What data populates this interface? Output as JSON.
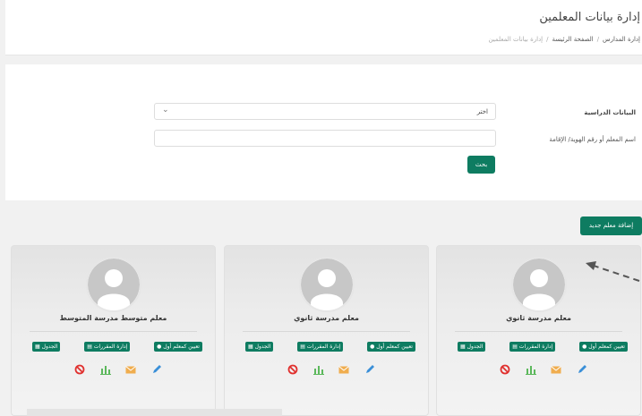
{
  "header": {
    "title": "إدارة بيانات المعلمين",
    "breadcrumb": [
      "إدارة المدارس",
      "الصفحة الرئيسة",
      "إدارة بيانات المعلمين"
    ]
  },
  "filter": {
    "section_label": "البيانات الدراسية",
    "select_value": "اختر",
    "id_label": "اسم المعلم أو رقم الهوية/ الإقامة",
    "id_value": "",
    "search_label": "بحث"
  },
  "add_button_label": "إضافة معلم جديد",
  "cards": [
    {
      "title": "معلم مدرسة ثانوي",
      "assign_label": "تعيين كمعلم أول",
      "courses_label": "إدارة المقررات",
      "schedule_label": "الجدول"
    },
    {
      "title": "معلم مدرسة ثانوي",
      "assign_label": "تعيين كمعلم أول",
      "courses_label": "إدارة المقررات",
      "schedule_label": "الجدول"
    },
    {
      "title": "معلم متوسط مدرسة المتوسط",
      "assign_label": "تعيين كمعلم أول",
      "courses_label": "إدارة المقررات",
      "schedule_label": "الجدول"
    }
  ],
  "colors": {
    "primary": "#0e7c61",
    "disable": "#e0302e",
    "stats": "#5cb85c",
    "mail": "#f0ad4e",
    "edit": "#3a8fd8"
  },
  "icons": [
    "user-icon",
    "book-icon",
    "calendar-icon",
    "block-icon",
    "chart-icon",
    "mail-icon",
    "edit-icon"
  ]
}
